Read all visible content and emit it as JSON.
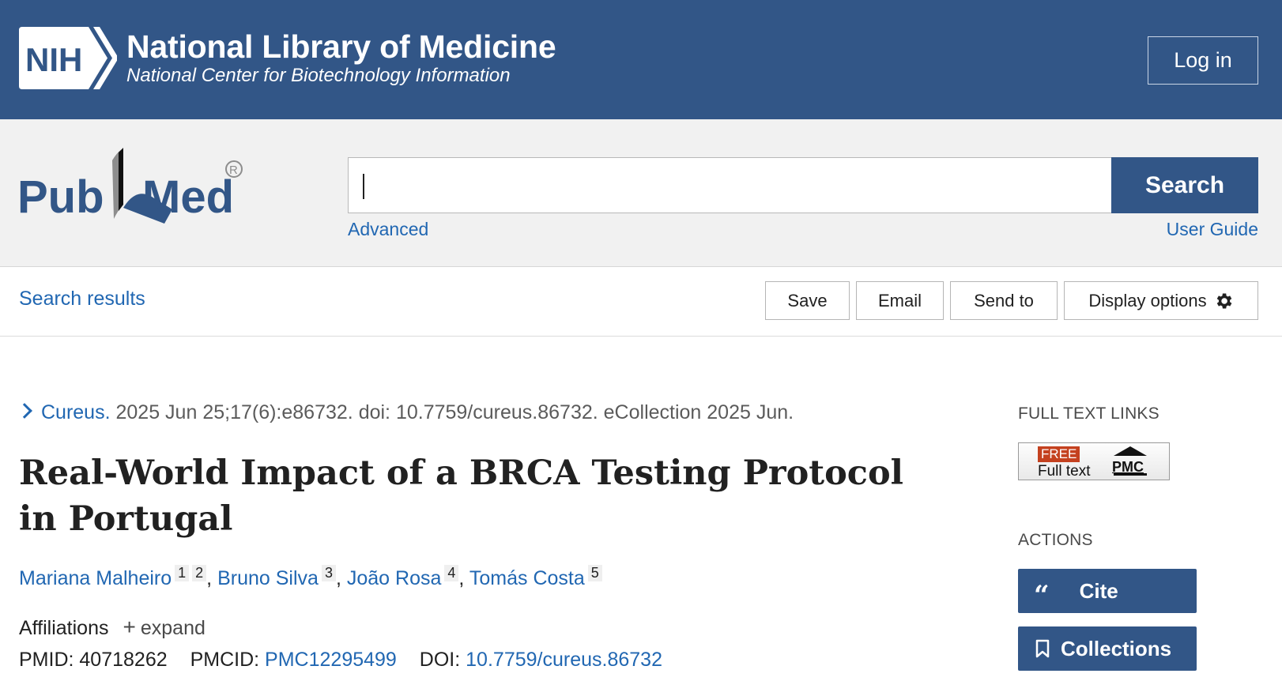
{
  "header": {
    "nih_logo_text": "NIH",
    "title": "National Library of Medicine",
    "subtitle": "National Center for Biotechnology Information",
    "login_label": "Log in"
  },
  "search": {
    "logo_text": "PubMed",
    "query": "",
    "button_label": "Search",
    "advanced_label": "Advanced",
    "user_guide_label": "User Guide"
  },
  "toolbar": {
    "results_link": "Search results",
    "save_label": "Save",
    "email_label": "Email",
    "send_to_label": "Send to",
    "display_options_label": "Display options"
  },
  "article": {
    "journal": "Cureus.",
    "citation_rest": "2025 Jun 25;17(6):e86732. doi: 10.7759/cureus.86732. eCollection 2025 Jun.",
    "title": "Real-World Impact of a BRCA Testing Protocol in Portugal",
    "authors": [
      {
        "name": "Mariana Malheiro",
        "affils": [
          "1",
          "2"
        ]
      },
      {
        "name": "Bruno Silva",
        "affils": [
          "3"
        ]
      },
      {
        "name": "João Rosa",
        "affils": [
          "4"
        ]
      },
      {
        "name": "Tomás Costa",
        "affils": [
          "5"
        ]
      }
    ],
    "affiliations_label": "Affiliations",
    "expand_label": "expand",
    "pmid_label": "PMID:",
    "pmid": "40718262",
    "pmcid_label": "PMCID:",
    "pmcid": "PMC12295499",
    "doi_label": "DOI:",
    "doi": "10.7759/cureus.86732"
  },
  "sidebar": {
    "full_text_links_label": "FULL TEXT LINKS",
    "badge_free": "FREE",
    "badge_full_text": "Full text",
    "badge_pmc": "PMC",
    "actions_label": "ACTIONS",
    "cite_label": "Cite",
    "collections_label": "Collections"
  },
  "colors": {
    "nih_blue": "#325687",
    "link_blue": "#2167b2",
    "free_red": "#c4411f"
  }
}
